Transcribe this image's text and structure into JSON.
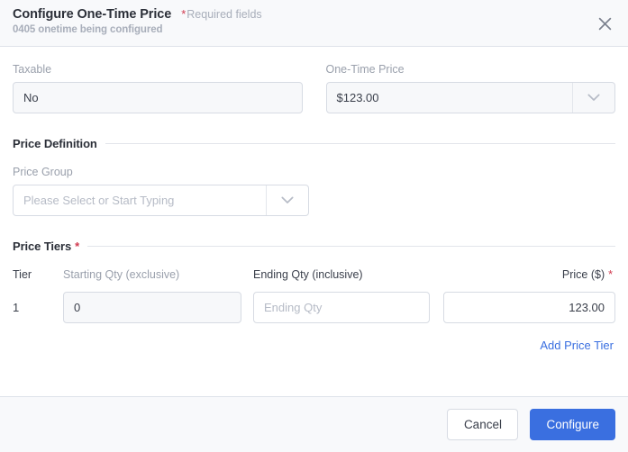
{
  "header": {
    "title": "Configure One-Time Price",
    "required_note": "Required fields",
    "required_asterisk": "*",
    "subtitle": "0405 onetime being configured",
    "close_icon": "close-icon"
  },
  "fields": {
    "taxable": {
      "label": "Taxable",
      "value": "No"
    },
    "one_time_price": {
      "label": "One-Time Price",
      "value": "$123.00",
      "caret_icon": "chevron-down-icon"
    }
  },
  "price_definition": {
    "section_title": "Price Definition",
    "price_group": {
      "label": "Price Group",
      "value": "",
      "placeholder": "Please Select or Start Typing",
      "caret_icon": "chevron-down-icon"
    }
  },
  "price_tiers": {
    "section_title": "Price Tiers",
    "section_asterisk": "*",
    "columns": {
      "tier": "Tier",
      "starting_qty": "Starting Qty (exclusive)",
      "ending_qty": "Ending Qty (inclusive)",
      "price": "Price ($)",
      "price_asterisk": "*"
    },
    "rows": [
      {
        "tier": "1",
        "starting_qty": "0",
        "ending_qty": "",
        "ending_qty_placeholder": "Ending Qty",
        "price": "123.00"
      }
    ],
    "add_link": "Add Price Tier"
  },
  "footer": {
    "cancel_label": "Cancel",
    "configure_label": "Configure"
  },
  "colors": {
    "accent": "#3a6fe0",
    "required": "#d0394e",
    "panel": "#f8f9fb",
    "border": "#dfe3ea"
  }
}
